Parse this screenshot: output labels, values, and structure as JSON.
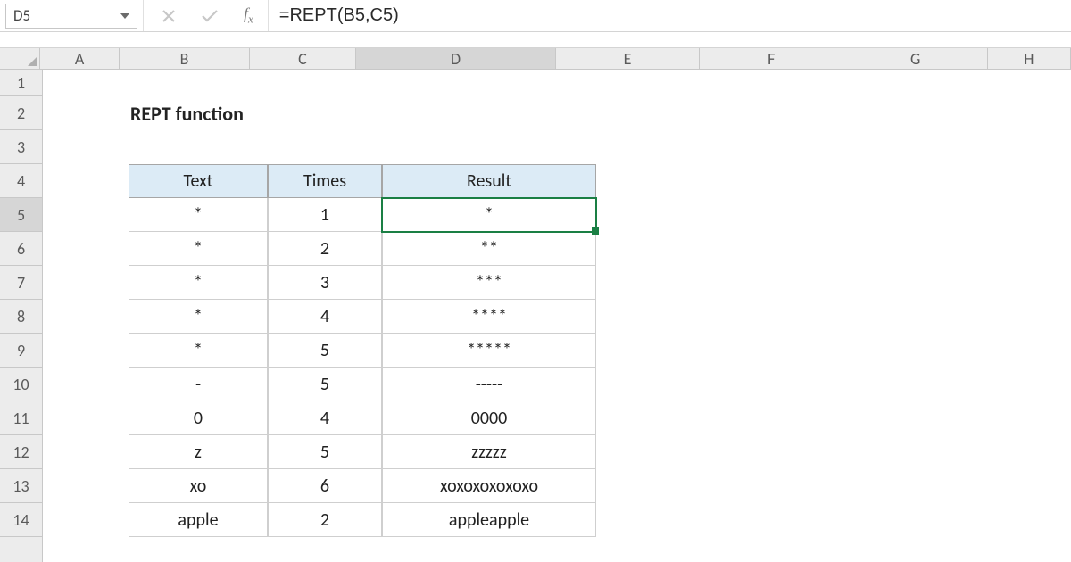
{
  "nameBox": "D5",
  "formula": "=REPT(B5,C5)",
  "columns": [
    "A",
    "B",
    "C",
    "D",
    "E",
    "F",
    "G",
    "H"
  ],
  "columnWidths": {
    "A": 96,
    "B": 156,
    "C": 128,
    "D": 240,
    "E": 173,
    "F": 173,
    "G": 173,
    "H": 100
  },
  "rowHeights": {
    "1": 30,
    "default": 38
  },
  "rowCount": 14,
  "activeCell": {
    "col": "D",
    "row": 5
  },
  "title": "REPT function",
  "table": {
    "startCol": "B",
    "headerRow": 4,
    "headers": [
      "Text",
      "Times",
      "Result"
    ],
    "rows": [
      {
        "text": "*",
        "times": "1",
        "result": "*"
      },
      {
        "text": "*",
        "times": "2",
        "result": "**"
      },
      {
        "text": "*",
        "times": "3",
        "result": "***"
      },
      {
        "text": "*",
        "times": "4",
        "result": "****"
      },
      {
        "text": "*",
        "times": "5",
        "result": "*****"
      },
      {
        "text": "-",
        "times": "5",
        "result": "-----"
      },
      {
        "text": "0",
        "times": "4",
        "result": "0000"
      },
      {
        "text": "z",
        "times": "5",
        "result": "zzzzz"
      },
      {
        "text": "xo",
        "times": "6",
        "result": "xoxoxoxoxoxo"
      },
      {
        "text": "apple",
        "times": "2",
        "result": "appleapple"
      }
    ]
  }
}
